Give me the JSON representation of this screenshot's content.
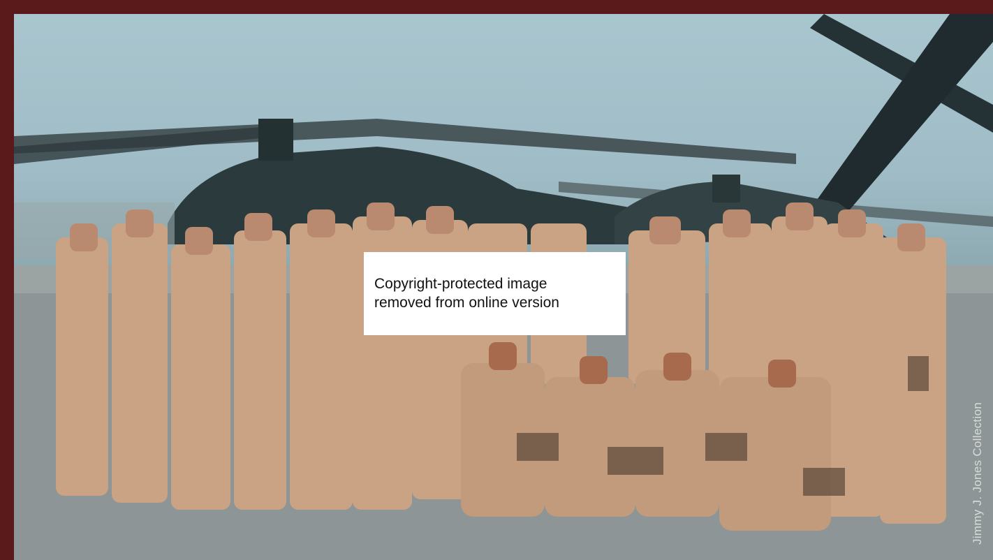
{
  "notice": {
    "line1": "Copyright-protected image",
    "line2": "removed from online version"
  },
  "credit": "Jimmy J. Jones Collection",
  "colors": {
    "frame": "#5a1a1c",
    "sky": "#a9c6cf",
    "uniform": "#c9a383",
    "helicopter": "#2b3a3c"
  }
}
